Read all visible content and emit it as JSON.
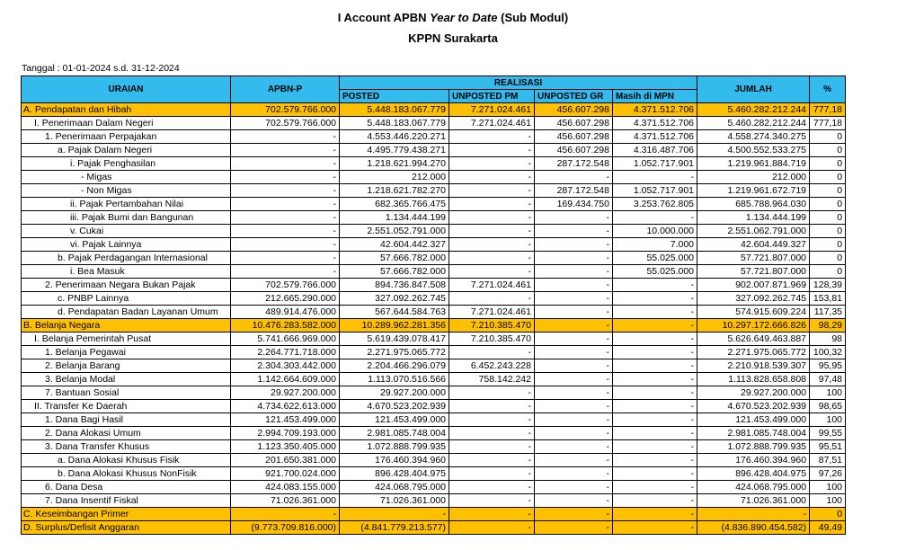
{
  "header": {
    "title_prefix": "I Account APBN ",
    "title_italic": "Year to Date",
    "title_suffix": " (Sub Modul)",
    "subtitle": "KPPN Surakarta",
    "date_range": "Tanggal : 01-01-2024  s.d. 31-12-2024"
  },
  "table": {
    "columns": {
      "uraian": "URAIAN",
      "apbnp": "APBN-P",
      "realisasi": "REALISASI",
      "posted": "POSTED",
      "unposted_pm": "UNPOSTED PM",
      "unposted_gr": "UNPOSTED GR",
      "masih_mpn": "Masih di MPN",
      "jumlah": "JUMLAH",
      "persen": "%"
    },
    "rows": [
      {
        "indent": 0,
        "hl": true,
        "uraian": "A. Pendapatan dan Hibah",
        "apbnp": "702.579.766.000",
        "posted": "5.448.183.067.779",
        "upm": "7.271.024.461",
        "ugr": "456.607.298",
        "mpn": "4.371.512.706",
        "jumlah": "5.460.282.212.244",
        "pct": "777,18"
      },
      {
        "indent": 1,
        "hl": false,
        "uraian": "I. Penerimaan Dalam Negeri",
        "apbnp": "702.579.766.000",
        "posted": "5.448.183.067.779",
        "upm": "7.271.024.461",
        "ugr": "456.607.298",
        "mpn": "4.371.512.706",
        "jumlah": "5.460.282.212.244",
        "pct": "777,18"
      },
      {
        "indent": 2,
        "hl": false,
        "uraian": "1. Penerimaan Perpajakan",
        "apbnp": "-",
        "posted": "4.553.446.220.271",
        "upm": "-",
        "ugr": "456.607.298",
        "mpn": "4.371.512.706",
        "jumlah": "4.558.274.340.275",
        "pct": "0"
      },
      {
        "indent": 3,
        "hl": false,
        "uraian": "a. Pajak Dalam Negeri",
        "apbnp": "-",
        "posted": "4.495.779.438.271",
        "upm": "-",
        "ugr": "456.607.298",
        "mpn": "4.316.487.706",
        "jumlah": "4.500.552.533.275",
        "pct": "0"
      },
      {
        "indent": 4,
        "hl": false,
        "uraian": "i. Pajak Penghasilan",
        "apbnp": "-",
        "posted": "1.218.621.994.270",
        "upm": "-",
        "ugr": "287.172.548",
        "mpn": "1.052.717.901",
        "jumlah": "1.219.961.884.719",
        "pct": "0"
      },
      {
        "indent": 5,
        "hl": false,
        "uraian": "- Migas",
        "apbnp": "-",
        "posted": "212.000",
        "upm": "-",
        "ugr": "-",
        "mpn": "-",
        "jumlah": "212.000",
        "pct": "0"
      },
      {
        "indent": 5,
        "hl": false,
        "uraian": "- Non Migas",
        "apbnp": "-",
        "posted": "1.218.621.782.270",
        "upm": "-",
        "ugr": "287.172.548",
        "mpn": "1.052.717.901",
        "jumlah": "1.219.961.672.719",
        "pct": "0"
      },
      {
        "indent": 4,
        "hl": false,
        "uraian": "ii. Pajak Pertambahan Nilai",
        "apbnp": "-",
        "posted": "682.365.766.475",
        "upm": "-",
        "ugr": "169.434.750",
        "mpn": "3.253.762.805",
        "jumlah": "685.788.964.030",
        "pct": "0"
      },
      {
        "indent": 4,
        "hl": false,
        "uraian": "iii. Pajak Bumi dan Bangunan",
        "apbnp": "-",
        "posted": "1.134.444.199",
        "upm": "-",
        "ugr": "-",
        "mpn": "-",
        "jumlah": "1.134.444.199",
        "pct": "0"
      },
      {
        "indent": 4,
        "hl": false,
        "uraian": "v. Cukai",
        "apbnp": "-",
        "posted": "2.551.052.791.000",
        "upm": "-",
        "ugr": "-",
        "mpn": "10.000.000",
        "jumlah": "2.551.062.791.000",
        "pct": "0"
      },
      {
        "indent": 4,
        "hl": false,
        "uraian": "vi. Pajak Lainnya",
        "apbnp": "-",
        "posted": "42.604.442.327",
        "upm": "-",
        "ugr": "-",
        "mpn": "7.000",
        "jumlah": "42.604.449.327",
        "pct": "0"
      },
      {
        "indent": 3,
        "hl": false,
        "uraian": "b. Pajak Perdagangan Internasional",
        "apbnp": "-",
        "posted": "57.666.782.000",
        "upm": "-",
        "ugr": "-",
        "mpn": "55.025.000",
        "jumlah": "57.721.807.000",
        "pct": "0"
      },
      {
        "indent": 4,
        "hl": false,
        "uraian": "i. Bea Masuk",
        "apbnp": "-",
        "posted": "57.666.782.000",
        "upm": "-",
        "ugr": "-",
        "mpn": "55.025.000",
        "jumlah": "57.721.807.000",
        "pct": "0"
      },
      {
        "indent": 2,
        "hl": false,
        "uraian": "2. Penerimaan Negara Bukan Pajak",
        "apbnp": "702.579.766.000",
        "posted": "894.736.847.508",
        "upm": "7.271.024.461",
        "ugr": "-",
        "mpn": "-",
        "jumlah": "902.007.871.969",
        "pct": "128,39"
      },
      {
        "indent": 3,
        "hl": false,
        "uraian": "c. PNBP Lainnya",
        "apbnp": "212.665.290.000",
        "posted": "327.092.262.745",
        "upm": "-",
        "ugr": "-",
        "mpn": "-",
        "jumlah": "327.092.262.745",
        "pct": "153,81"
      },
      {
        "indent": 3,
        "hl": false,
        "uraian": "d. Pendapatan Badan Layanan Umum",
        "apbnp": "489.914.476.000",
        "posted": "567.644.584.763",
        "upm": "7.271.024.461",
        "ugr": "-",
        "mpn": "-",
        "jumlah": "574.915.609.224",
        "pct": "117,35"
      },
      {
        "indent": 0,
        "hl": true,
        "uraian": "B. Belanja Negara",
        "apbnp": "10.476.283.582.000",
        "posted": "10.289.962.281.356",
        "upm": "7.210.385.470",
        "ugr": "-",
        "mpn": "-",
        "jumlah": "10.297.172.666.826",
        "pct": "98,29"
      },
      {
        "indent": 1,
        "hl": false,
        "uraian": "I. Belanja Pemerintah Pusat",
        "apbnp": "5.741.666.969.000",
        "posted": "5.619.439.078.417",
        "upm": "7.210.385.470",
        "ugr": "-",
        "mpn": "-",
        "jumlah": "5.626.649.463.887",
        "pct": "98"
      },
      {
        "indent": 2,
        "hl": false,
        "uraian": "1. Belanja Pegawai",
        "apbnp": "2.264.771.718.000",
        "posted": "2.271.975.065.772",
        "upm": "-",
        "ugr": "-",
        "mpn": "-",
        "jumlah": "2.271.975.065.772",
        "pct": "100,32"
      },
      {
        "indent": 2,
        "hl": false,
        "uraian": "2. Belanja Barang",
        "apbnp": "2.304.303.442.000",
        "posted": "2.204.466.296.079",
        "upm": "6.452.243.228",
        "ugr": "-",
        "mpn": "-",
        "jumlah": "2.210.918.539.307",
        "pct": "95,95"
      },
      {
        "indent": 2,
        "hl": false,
        "uraian": "3. Belanja Modal",
        "apbnp": "1.142.664.609.000",
        "posted": "1.113.070.516.566",
        "upm": "758.142.242",
        "ugr": "-",
        "mpn": "-",
        "jumlah": "1.113.828.658.808",
        "pct": "97,48"
      },
      {
        "indent": 2,
        "hl": false,
        "uraian": "7. Bantuan Sosial",
        "apbnp": "29.927.200.000",
        "posted": "29.927.200.000",
        "upm": "-",
        "ugr": "-",
        "mpn": "-",
        "jumlah": "29.927.200.000",
        "pct": "100"
      },
      {
        "indent": 1,
        "hl": false,
        "uraian": "II. Transfer Ke Daerah",
        "apbnp": "4.734.622.613.000",
        "posted": "4.670.523.202.939",
        "upm": "-",
        "ugr": "-",
        "mpn": "-",
        "jumlah": "4.670.523.202.939",
        "pct": "98,65"
      },
      {
        "indent": 2,
        "hl": false,
        "uraian": "1. Dana Bagi Hasil",
        "apbnp": "121.453.499.000",
        "posted": "121.453.499.000",
        "upm": "-",
        "ugr": "-",
        "mpn": "-",
        "jumlah": "121.453.499.000",
        "pct": "100"
      },
      {
        "indent": 2,
        "hl": false,
        "uraian": "2. Dana Alokasi Umum",
        "apbnp": "2.994.709.193.000",
        "posted": "2.981.085.748.004",
        "upm": "-",
        "ugr": "-",
        "mpn": "-",
        "jumlah": "2.981.085.748.004",
        "pct": "99,55"
      },
      {
        "indent": 2,
        "hl": false,
        "uraian": "3. Dana Transfer Khusus",
        "apbnp": "1.123.350.405.000",
        "posted": "1.072.888.799.935",
        "upm": "-",
        "ugr": "-",
        "mpn": "-",
        "jumlah": "1.072.888.799.935",
        "pct": "95,51"
      },
      {
        "indent": 3,
        "hl": false,
        "uraian": "a. Dana Alokasi Khusus Fisik",
        "apbnp": "201.650.381.000",
        "posted": "176.460.394.960",
        "upm": "-",
        "ugr": "-",
        "mpn": "-",
        "jumlah": "176.460.394.960",
        "pct": "87,51"
      },
      {
        "indent": 3,
        "hl": false,
        "uraian": "b. Dana Alokasi Khusus NonFisik",
        "apbnp": "921.700.024.000",
        "posted": "896.428.404.975",
        "upm": "-",
        "ugr": "-",
        "mpn": "-",
        "jumlah": "896.428.404.975",
        "pct": "97,26"
      },
      {
        "indent": 2,
        "hl": false,
        "uraian": "6. Dana Desa",
        "apbnp": "424.083.155.000",
        "posted": "424.068.795.000",
        "upm": "-",
        "ugr": "-",
        "mpn": "-",
        "jumlah": "424.068.795.000",
        "pct": "100"
      },
      {
        "indent": 2,
        "hl": false,
        "uraian": "7. Dana Insentif Fiskal",
        "apbnp": "71.026.361.000",
        "posted": "71.026.361.000",
        "upm": "-",
        "ugr": "-",
        "mpn": "-",
        "jumlah": "71.026.361.000",
        "pct": "100"
      },
      {
        "indent": 0,
        "hl": true,
        "uraian": "C. Keseimbangan Primer",
        "apbnp": "-",
        "posted": "-",
        "upm": "-",
        "ugr": "-",
        "mpn": "-",
        "jumlah": "-",
        "pct": "0"
      },
      {
        "indent": 0,
        "hl": true,
        "uraian": "D. Surplus/Defisit Anggaran",
        "apbnp": "(9.773.709.816.000)",
        "posted": "(4.841.779.213.577)",
        "upm": "-",
        "ugr": "-",
        "mpn": "-",
        "jumlah": "(4.836.890.454.582)",
        "pct": "49,49"
      }
    ]
  }
}
